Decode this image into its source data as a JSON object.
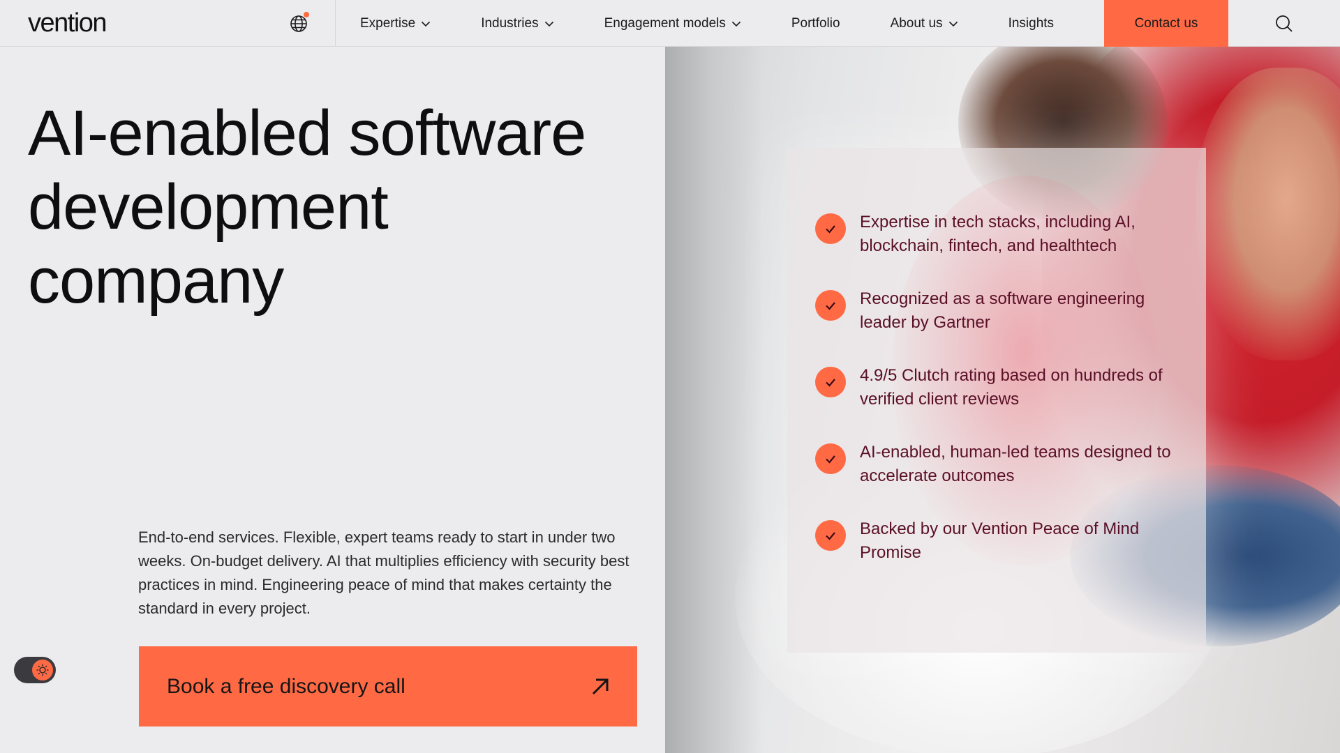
{
  "brand": {
    "logo_text": "vention",
    "accent": "#ff6a45",
    "text_dark": "#111111",
    "feature_text_color": "#5a0f26"
  },
  "header": {
    "language_icon": "globe-icon",
    "nav": [
      {
        "label": "Expertise",
        "has_dropdown": true
      },
      {
        "label": "Industries",
        "has_dropdown": true
      },
      {
        "label": "Engagement models",
        "has_dropdown": true
      },
      {
        "label": "Portfolio",
        "has_dropdown": false
      },
      {
        "label": "About us",
        "has_dropdown": true
      },
      {
        "label": "Insights",
        "has_dropdown": false
      }
    ],
    "contact_label": "Contact us",
    "search_icon": "search-icon"
  },
  "hero": {
    "title_lines": [
      "AI-enabled software",
      "development",
      "company"
    ],
    "description": "End-to-end services. Flexible, expert teams ready to start in under two weeks. On-budget delivery. AI that multiplies efficiency with security best practices in mind. Engineering peace of mind that makes certainty the standard in every project.",
    "cta_label": "Book a free discovery call",
    "cta_icon": "arrow-up-right-icon"
  },
  "features": [
    {
      "text": "Expertise in tech stacks, including AI, blockchain, fintech, and healthtech"
    },
    {
      "text": "Recognized as a software engineering leader by Gartner"
    },
    {
      "text": "4.9/5 Clutch rating based on hundreds of verified client reviews"
    },
    {
      "text": "AI-enabled, human-led teams designed to accelerate outcomes"
    },
    {
      "text": "Backed by our Vention Peace of Mind Promise"
    }
  ],
  "theme_toggle": {
    "icon": "sun-icon"
  }
}
